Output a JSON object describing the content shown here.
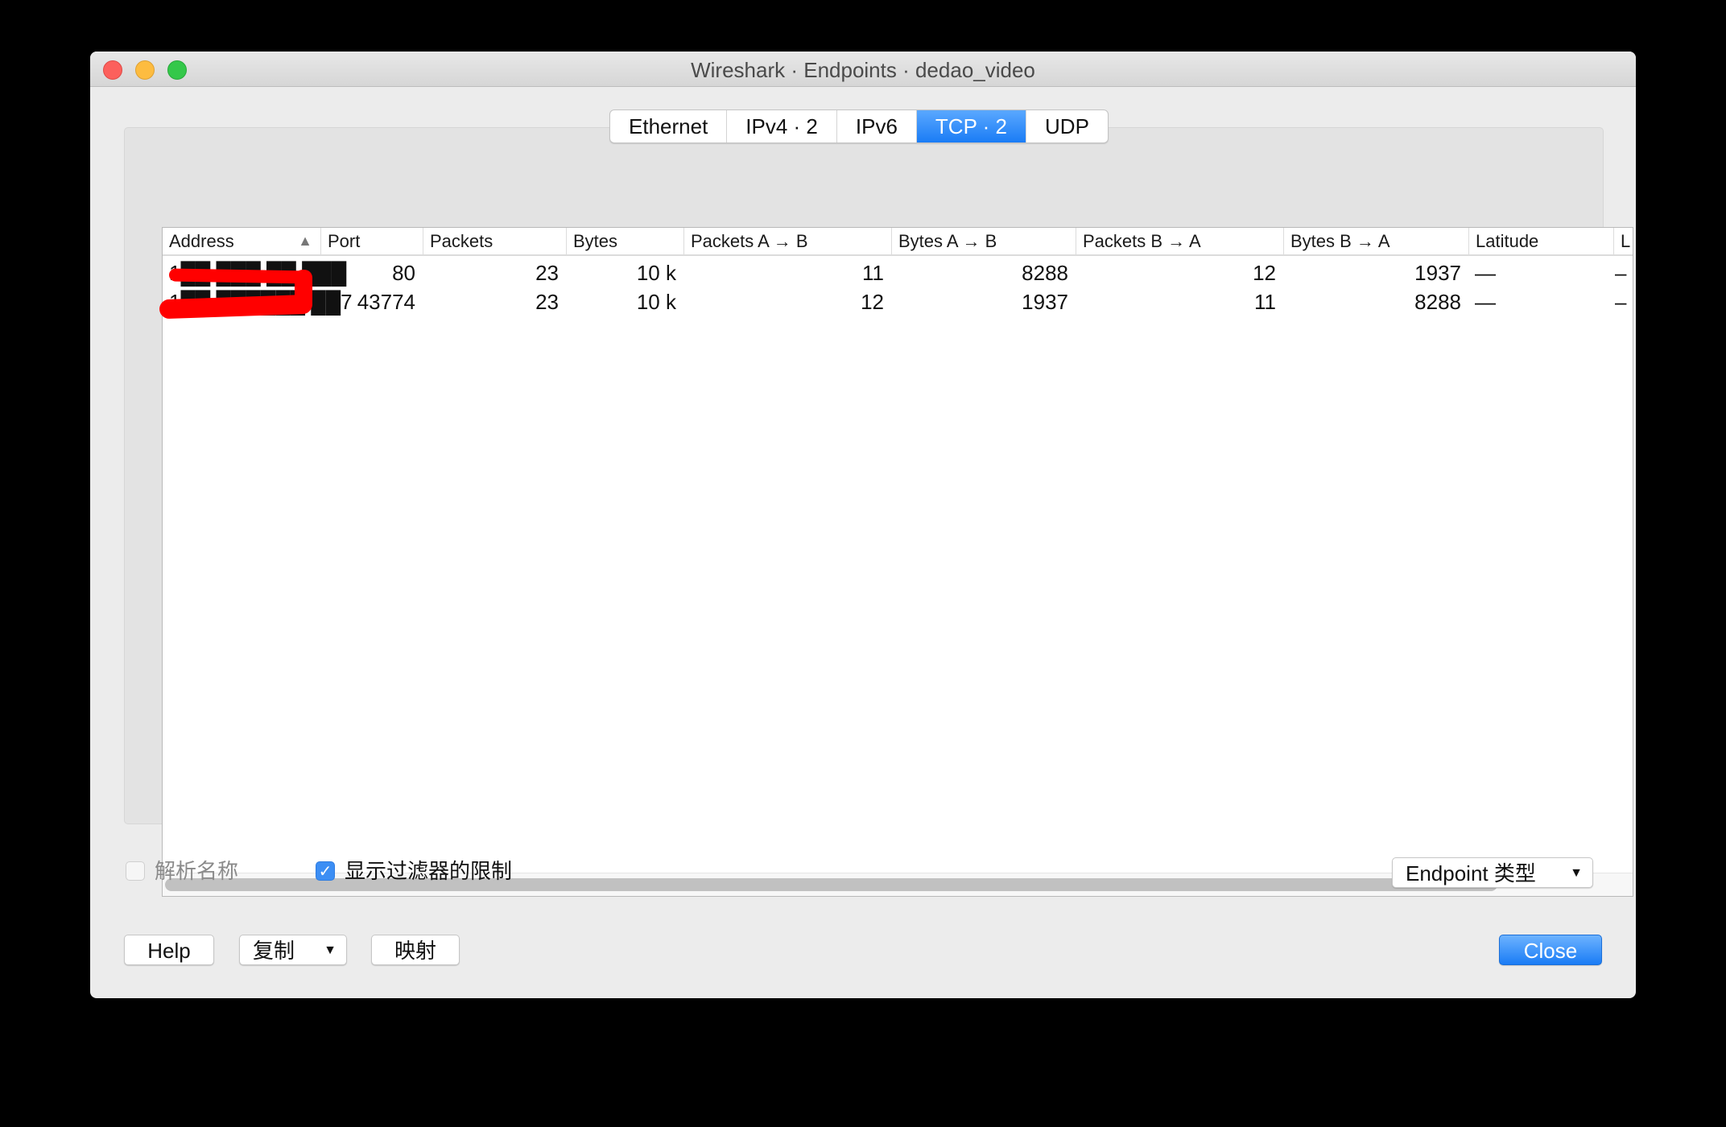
{
  "window": {
    "title": "Wireshark · Endpoints · dedao_video"
  },
  "tabs": [
    {
      "label": "Ethernet",
      "active": false
    },
    {
      "label": "IPv4 · 2",
      "active": false
    },
    {
      "label": "IPv6",
      "active": false
    },
    {
      "label": "TCP · 2",
      "active": true
    },
    {
      "label": "UDP",
      "active": false
    }
  ],
  "table": {
    "columns": [
      "Address",
      "Port",
      "Packets",
      "Bytes",
      "Packets A → B",
      "Bytes A → B",
      "Packets B → A",
      "Bytes B → A",
      "Latitude",
      "L"
    ],
    "sort_indicator": "▲",
    "rows": [
      {
        "address": "1██.███.██.███",
        "port": "80",
        "packets": "23",
        "bytes": "10 k",
        "packets_ab": "11",
        "bytes_ab": "8288",
        "packets_ba": "12",
        "bytes_ba": "1937",
        "latitude": "—",
        "longitude": "–"
      },
      {
        "address": "1██.██████.██7",
        "port": "43774",
        "packets": "23",
        "bytes": "10 k",
        "packets_ab": "12",
        "bytes_ab": "1937",
        "packets_ba": "11",
        "bytes_ba": "8288",
        "latitude": "—",
        "longitude": "–"
      }
    ]
  },
  "options": {
    "resolve_names": {
      "label": "解析名称",
      "checked": false,
      "enabled": false
    },
    "limit_to_filter": {
      "label": "显示过滤器的限制",
      "checked": true
    },
    "endpoint_type": {
      "label": "Endpoint 类型"
    }
  },
  "buttons": {
    "help": "Help",
    "copy": "复制",
    "map": "映射",
    "close": "Close"
  },
  "icons": {
    "checkmark": "✓",
    "dropdown": "▼"
  },
  "colors": {
    "accent": "#1a7cf5",
    "redaction": "#ff0000"
  }
}
